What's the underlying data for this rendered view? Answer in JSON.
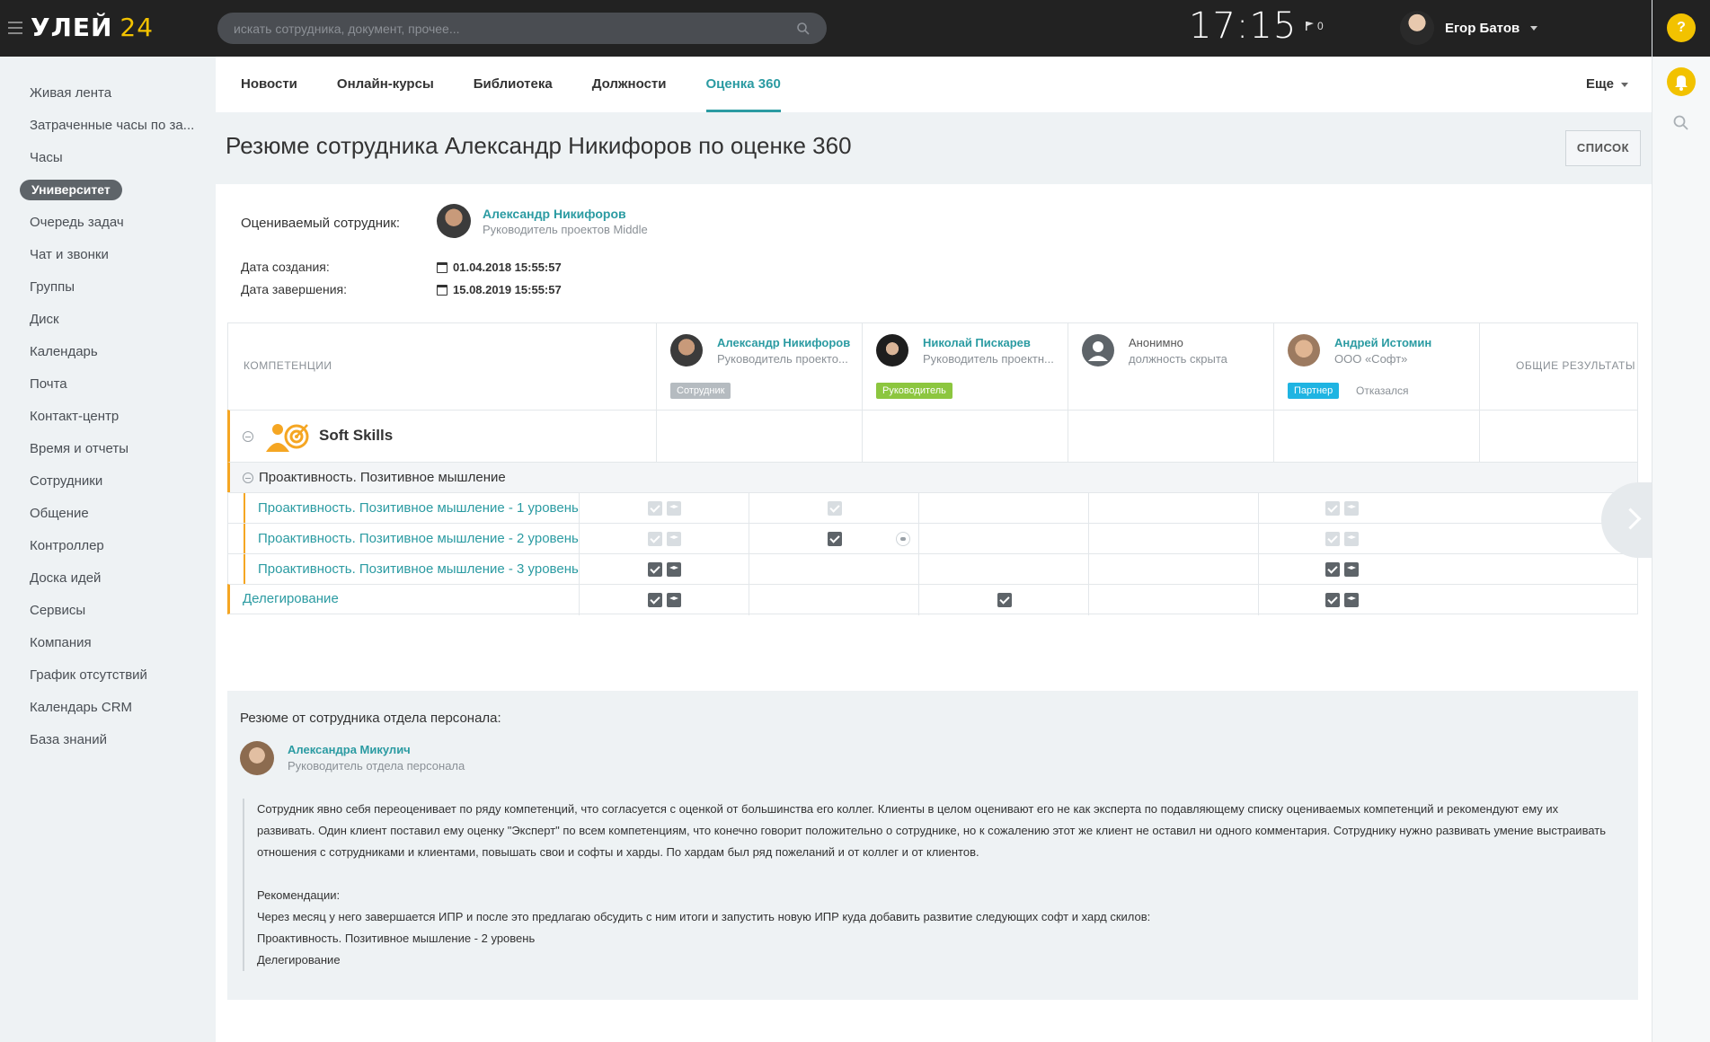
{
  "topbar": {
    "logo_text": "УЛЕЙ",
    "logo_num": "24",
    "search_placeholder": "искать сотрудника, документ, прочее...",
    "clock": "17:15",
    "flag_count": "0",
    "user_name": "Егор Батов",
    "help_label": "?"
  },
  "sidebar": {
    "items": [
      "Живая лента",
      "Затраченные часы по за...",
      "Часы",
      "Университет",
      "Очередь задач",
      "Чат и звонки",
      "Группы",
      "Диск",
      "Календарь",
      "Почта",
      "Контакт-центр",
      "Время и отчеты",
      "Сотрудники",
      "Общение",
      "Контроллер",
      "Доска идей",
      "Сервисы",
      "Компания",
      "График отсутствий",
      "Календарь CRM",
      "База знаний"
    ],
    "active_index": 3
  },
  "tabs": {
    "items": [
      "Новости",
      "Онлайн-курсы",
      "Библиотека",
      "Должности",
      "Оценка 360"
    ],
    "active_index": 4,
    "more": "Еще"
  },
  "page": {
    "title": "Резюме сотрудника Александр Никифоров по оценке 360",
    "list_button": "СПИСОК"
  },
  "info": {
    "evaluated_label": "Оцениваемый сотрудник:",
    "evaluated_name": "Александр Никифоров",
    "evaluated_position": "Руководитель проектов Middle",
    "created_label": "Дата создания:",
    "created_value": "01.04.2018 15:55:57",
    "finished_label": "Дата завершения:",
    "finished_value": "15.08.2019 15:55:57"
  },
  "table": {
    "competencies_header": "КОМПЕТЕНЦИИ",
    "total_header": "ОБЩИЕ РЕЗУЛЬТАТЫ",
    "evaluators": [
      {
        "name": "Александр Никифоров",
        "position": "Руководитель проекто...",
        "badge": "Сотрудник",
        "badge_color": "#b5bbc0",
        "status": ""
      },
      {
        "name": "Николай Пискарев",
        "position": "Руководитель проектн...",
        "badge": "Руководитель",
        "badge_color": "#8cc63f",
        "status": ""
      },
      {
        "name": "Анонимно",
        "position": "должность скрыта",
        "badge": "",
        "badge_color": "",
        "status": ""
      },
      {
        "name": "Андрей Истомин",
        "position": "ООО «Софт»",
        "badge": "Партнер",
        "badge_color": "#1fb4e2",
        "status": "Отказался"
      }
    ],
    "group_title": "Soft Skills",
    "subgroup_title": "Проактивность. Позитивное мышление",
    "rows": [
      "Проактивность. Позитивное мышление - 1 уровень",
      "Проактивность. Позитивное мышление - 2 уровень",
      "Проактивность. Позитивное мышление - 3 уровень",
      "Делегирование"
    ]
  },
  "summary": {
    "title": "Резюме от сотрудника отдела персонала:",
    "author_name": "Александра Микулич",
    "author_position": "Руководитель отдела персонала",
    "paragraph": "Сотрудник явно себя переоценивает по ряду компетенций, что согласуется с оценкой от большинства его коллег. Клиенты в целом оценивают его не как эксперта по подавляющему списку оцениваемых компетенций и рекомендуют ему их развивать. Один клиент поставил ему оценку \"Эксперт\" по всем компетенциям, что конечно говорит положительно о сотруднике, но к сожалению этот же клиент не оставил ни одного комментария. Сотруднику нужно развивать умение выстраивать отношения с сотрудниками и клиентами, повышать свои и софты и харды. По хардам был ряд пожеланий и от коллег и от клиентов.",
    "rec_title": "Рекомендации:",
    "rec_line1": "Через месяц у него завершается ИПР и после это предлагаю обсудить с ним итоги и запустить новую ИПР куда добавить развитие следующих софт и хард скилов:",
    "rec_line2": "Проактивность. Позитивное мышление - 2 уровень",
    "rec_line3": "Делегирование"
  }
}
